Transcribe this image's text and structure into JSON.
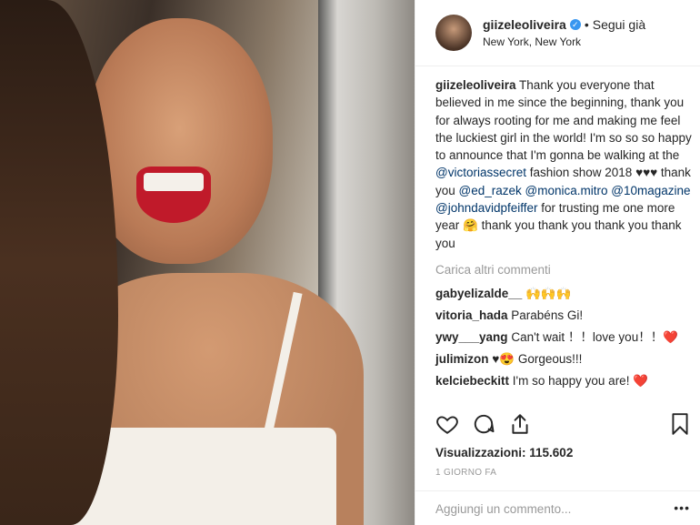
{
  "header": {
    "username": "giizeleoliveira",
    "verified_icon": "verified-badge-icon",
    "separator": "•",
    "follow_label": "Segui già",
    "location": "New York, New York"
  },
  "caption": {
    "username": "giizeleoliveira",
    "text_1": " Thank you everyone that believed in me since the beginning, thank you for always rooting for me and making me feel the luckiest girl in the world! I'm so so so happy to announce that I'm gonna be walking at the ",
    "mention_1": "@victoriassecret",
    "text_2": " fashion show 2018 ♥♥♥ thank you ",
    "mention_2": "@ed_razek",
    "mention_3": "@monica.mitro",
    "mention_4": "@10magazine",
    "mention_5": "@johndavidpfeiffer",
    "text_3": " for trusting me one more year 🤗 thank you thank you thank you thank you"
  },
  "load_more": "Carica altri commenti",
  "comments": [
    {
      "user": "gabyelizalde__",
      "text": " 🙌🙌🙌"
    },
    {
      "user": "vitoria_hada",
      "text": " Parabéns Gi!"
    },
    {
      "user": "ywy___yang",
      "text": " Can't wait ！！love you！！❤️"
    },
    {
      "user": "julimizon",
      "text": " ♥😍 Gorgeous!!!"
    },
    {
      "user": "kelciebeckitt",
      "text": " I'm so happy you are! ❤️"
    }
  ],
  "views": "Visualizzazioni: 115.602",
  "timestamp": "1 GIORNO FA",
  "add_comment_placeholder": "Aggiungi un commento...",
  "more_menu": "•••"
}
